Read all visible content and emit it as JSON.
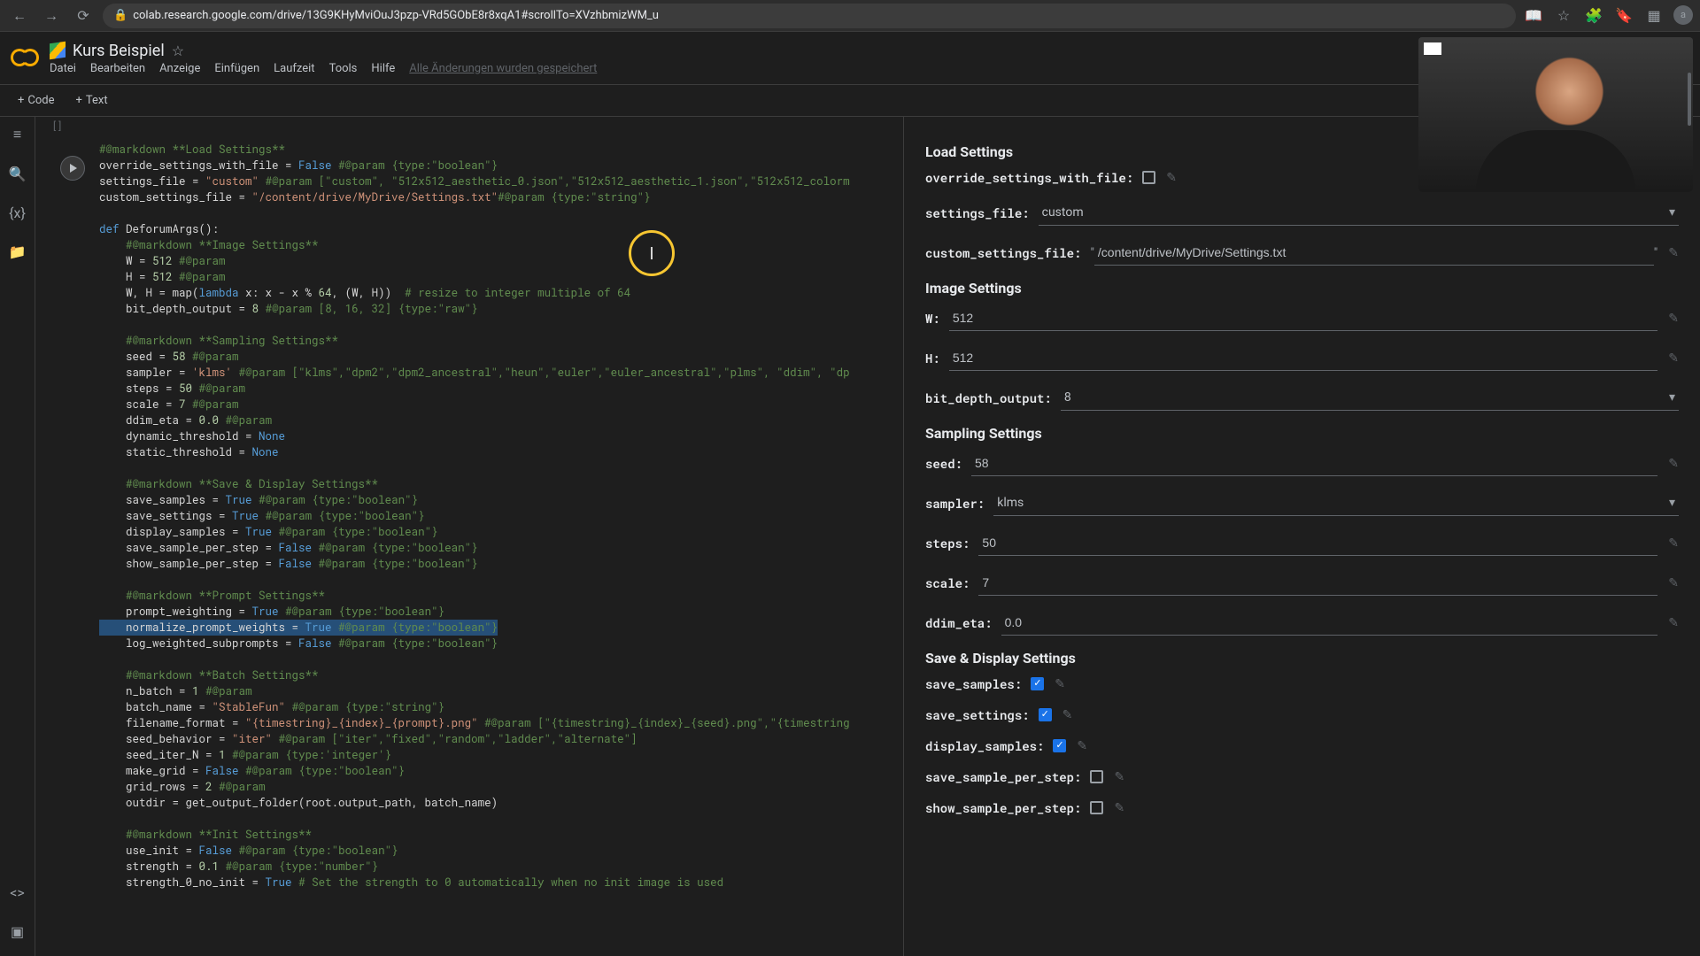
{
  "browser": {
    "url": "colab.research.google.com/drive/13G9KHyMviOuJ3pzp-VRd5GObE8r8xqA1#scrollTo=XVzhbmizWM_u"
  },
  "header": {
    "doc_title": "Kurs Beispiel",
    "menu": [
      "Datei",
      "Bearbeiten",
      "Anzeige",
      "Einfügen",
      "Laufzeit",
      "Tools",
      "Hilfe"
    ],
    "save_status": "Alle Änderungen wurden gespeichert"
  },
  "toolbar": {
    "code": "Code",
    "text": "Text"
  },
  "cell_prefix": "[ ]",
  "code_lines": [
    {
      "t": "#@markdown **Load Settings**",
      "cls": "s-comment"
    },
    {
      "raw": "override_settings_with_file = <span class='s-bool'>False</span> <span class='s-comment'>#@param {type:\"boolean\"}</span>"
    },
    {
      "raw": "settings_file = <span class='s-str'>\"custom\"</span> <span class='s-comment'>#@param [\"custom\", \"512x512_aesthetic_0.json\",\"512x512_aesthetic_1.json\",\"512x512_colorm</span>"
    },
    {
      "raw": "custom_settings_file = <span class='s-str'>\"/content/drive/MyDrive/Settings.txt\"</span><span class='s-comment'>#@param {type:\"string\"}</span>"
    },
    {
      "t": "",
      "cls": ""
    },
    {
      "raw": "<span class='s-key'>def</span> DeforumArgs():"
    },
    {
      "t": "    #@markdown **Image Settings**",
      "cls": "s-comment"
    },
    {
      "raw": "    W = <span class='s-num'>512</span> <span class='s-comment'>#@param</span>"
    },
    {
      "raw": "    H = <span class='s-num'>512</span> <span class='s-comment'>#@param</span>"
    },
    {
      "raw": "    W, H = map(<span class='s-key'>lambda</span> x: x - x % <span class='s-num'>64</span>, (W, H))  <span class='s-comment'># resize to integer multiple of 64</span>"
    },
    {
      "raw": "    bit_depth_output = <span class='s-num'>8</span> <span class='s-comment'>#@param [8, 16, 32] {type:\"raw\"}</span>"
    },
    {
      "t": "",
      "cls": ""
    },
    {
      "t": "    #@markdown **Sampling Settings**",
      "cls": "s-comment"
    },
    {
      "raw": "    seed = <span class='s-num'>58</span> <span class='s-comment'>#@param</span>"
    },
    {
      "raw": "    sampler = <span class='s-str'>'klms'</span> <span class='s-comment'>#@param [\"klms\",\"dpm2\",\"dpm2_ancestral\",\"heun\",\"euler\",\"euler_ancestral\",\"plms\", \"ddim\", \"dp</span>"
    },
    {
      "raw": "    steps = <span class='s-num'>50</span> <span class='s-comment'>#@param</span>"
    },
    {
      "raw": "    scale = <span class='s-num'>7</span> <span class='s-comment'>#@param</span>"
    },
    {
      "raw": "    ddim_eta = <span class='s-num'>0.0</span> <span class='s-comment'>#@param</span>"
    },
    {
      "raw": "    dynamic_threshold = <span class='s-none'>None</span>"
    },
    {
      "raw": "    static_threshold = <span class='s-none'>None</span>"
    },
    {
      "t": "",
      "cls": ""
    },
    {
      "t": "    #@markdown **Save & Display Settings**",
      "cls": "s-comment"
    },
    {
      "raw": "    save_samples = <span class='s-bool'>True</span> <span class='s-comment'>#@param {type:\"boolean\"}</span>"
    },
    {
      "raw": "    save_settings = <span class='s-bool'>True</span> <span class='s-comment'>#@param {type:\"boolean\"}</span>"
    },
    {
      "raw": "    display_samples = <span class='s-bool'>True</span> <span class='s-comment'>#@param {type:\"boolean\"}</span>"
    },
    {
      "raw": "    save_sample_per_step = <span class='s-bool'>False</span> <span class='s-comment'>#@param {type:\"boolean\"}</span>"
    },
    {
      "raw": "    show_sample_per_step = <span class='s-bool'>False</span> <span class='s-comment'>#@param {type:\"boolean\"}</span>"
    },
    {
      "t": "",
      "cls": ""
    },
    {
      "t": "    #@markdown **Prompt Settings**",
      "cls": "s-comment"
    },
    {
      "raw": "    prompt_weighting = <span class='s-bool'>True</span> <span class='s-comment'>#@param {type:\"boolean\"}</span>"
    },
    {
      "raw": "<span class='hl'>    normalize_prompt_weights = <span class='s-bool'>True</span> <span class='s-comment'>#@param {type:\"boolean\"}</span></span>"
    },
    {
      "raw": "    log_weighted_subprompts = <span class='s-bool'>False</span> <span class='s-comment'>#@param {type:\"boolean\"}</span>"
    },
    {
      "t": "",
      "cls": ""
    },
    {
      "t": "    #@markdown **Batch Settings**",
      "cls": "s-comment"
    },
    {
      "raw": "    n_batch = <span class='s-num'>1</span> <span class='s-comment'>#@param</span>"
    },
    {
      "raw": "    batch_name = <span class='s-str'>\"StableFun\"</span> <span class='s-comment'>#@param {type:\"string\"}</span>"
    },
    {
      "raw": "    filename_format = <span class='s-str'>\"{timestring}_{index}_{prompt}.png\"</span> <span class='s-comment'>#@param [\"{timestring}_{index}_{seed}.png\",\"{timestring</span>"
    },
    {
      "raw": "    seed_behavior = <span class='s-str'>\"iter\"</span> <span class='s-comment'>#@param [\"iter\",\"fixed\",\"random\",\"ladder\",\"alternate\"]</span>"
    },
    {
      "raw": "    seed_iter_N = <span class='s-num'>1</span> <span class='s-comment'>#@param {type:'integer'}</span>"
    },
    {
      "raw": "    make_grid = <span class='s-bool'>False</span> <span class='s-comment'>#@param {type:\"boolean\"}</span>"
    },
    {
      "raw": "    grid_rows = <span class='s-num'>2</span> <span class='s-comment'>#@param</span>"
    },
    {
      "raw": "    outdir = get_output_folder(root.output_path, batch_name)"
    },
    {
      "t": "",
      "cls": ""
    },
    {
      "t": "    #@markdown **Init Settings**",
      "cls": "s-comment"
    },
    {
      "raw": "    use_init = <span class='s-bool'>False</span> <span class='s-comment'>#@param {type:\"boolean\"}</span>"
    },
    {
      "raw": "    strength = <span class='s-num'>0.1</span> <span class='s-comment'>#@param {type:\"number\"}</span>"
    },
    {
      "raw": "    strength_0_no_init = <span class='s-bool'>True</span> <span class='s-comment'># Set the strength to 0 automatically when no init image is used</span>"
    }
  ],
  "form": {
    "sections": {
      "load": "Load Settings",
      "image": "Image Settings",
      "sampling": "Sampling Settings",
      "save": "Save & Display Settings"
    },
    "override_label": "override_settings_with_file:",
    "override_checked": false,
    "settings_file_label": "settings_file:",
    "settings_file_value": "custom",
    "custom_file_label": "custom_settings_file:",
    "custom_file_value": "/content/drive/MyDrive/Settings.txt",
    "w_label": "W:",
    "w_value": "512",
    "h_label": "H:",
    "h_value": "512",
    "bitdepth_label": "bit_depth_output:",
    "bitdepth_value": "8",
    "seed_label": "seed:",
    "seed_value": "58",
    "sampler_label": "sampler:",
    "sampler_value": "klms",
    "steps_label": "steps:",
    "steps_value": "50",
    "scale_label": "scale:",
    "scale_value": "7",
    "ddim_label": "ddim_eta:",
    "ddim_value": "0.0",
    "save_samples_label": "save_samples:",
    "save_settings_label": "save_settings:",
    "display_samples_label": "display_samples:",
    "save_per_step_label": "save_sample_per_step:",
    "show_per_step_label": "show_sample_per_step:"
  }
}
